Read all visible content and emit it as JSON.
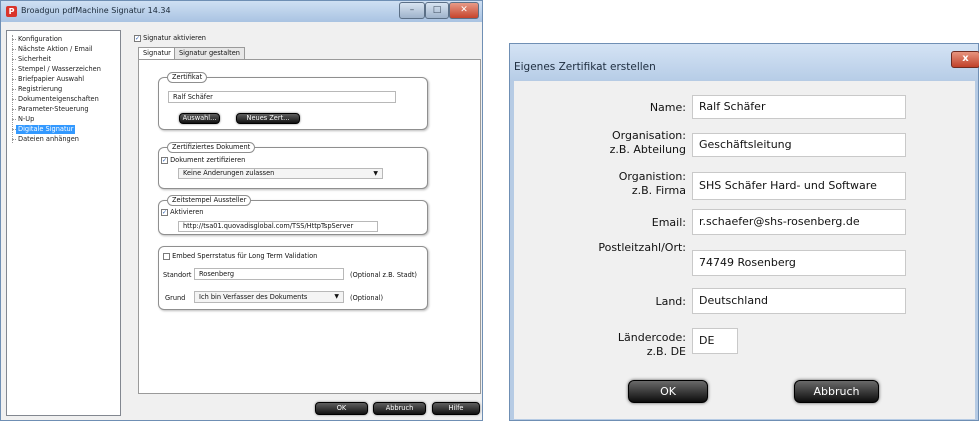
{
  "left_window": {
    "title": "Broadgun pdfMachine Signatur 14.34",
    "tree_items": [
      "Konfiguration",
      "Nächste Aktion / Email",
      "Sicherheit",
      "Stempel / Wasserzeichen",
      "Briefpapier Auswahl",
      "Registrierung",
      "Dokumenteigenschaften",
      "Parameter-Steuerung",
      "N-Up",
      "Digitale Signatur",
      "Dateien anhängen"
    ],
    "selected_tree_item": "Digitale Signatur",
    "enable_signature": {
      "checked": true,
      "label": "Signatur aktivieren"
    },
    "tabs": [
      "Signatur",
      "Signatur gestalten"
    ],
    "active_tab": "Signatur",
    "certificate": {
      "group_title": "Zertifikat",
      "name_value": "Ralf Schäfer",
      "select_button": "Auswahl...",
      "new_cert_button": "Neues Zert..."
    },
    "certified_document": {
      "group_title": "Zertifiziertes Dokument",
      "checkbox_label": "Dokument zertifizieren",
      "checked": true,
      "dropdown_value": "Keine Änderungen zulassen"
    },
    "timestamp": {
      "group_title": "Zeitstempel Aussteller",
      "checkbox_label": "Aktivieren",
      "checked": true,
      "url_value": "http://tsa01.quovadisglobal.com/TSS/HttpTspServer"
    },
    "ltv": {
      "checkbox_label": "Embed Sperrstatus für Long Term Validation",
      "checked": false,
      "location_label": "Standort",
      "location_value": "Rosenberg",
      "location_hint": "(Optional z.B. Stadt)",
      "reason_label": "Grund",
      "reason_value": "Ich bin Verfasser des Dokuments",
      "reason_hint": "(Optional)"
    },
    "buttons": {
      "ok": "OK",
      "cancel": "Abbruch",
      "help": "Hilfe"
    }
  },
  "dialog": {
    "title": "Eigenes Zertifikat erstellen",
    "close_glyph": "x",
    "fields": [
      {
        "label": "Name:",
        "value": "Ralf Schäfer"
      },
      {
        "label": "Organisation:",
        "sublabel": "z.B. Abteilung",
        "value": "Geschäftsleitung"
      },
      {
        "label": "Organistion:",
        "sublabel": "z.B. Firma",
        "value": "SHS Schäfer Hard- und Software"
      },
      {
        "label": "Email:",
        "value": "r.schaefer@shs-rosenberg.de"
      },
      {
        "label": "Postleitzahl/Ort:",
        "value": "74749 Rosenberg"
      },
      {
        "label": "Land:",
        "value": "Deutschland"
      },
      {
        "label": "Ländercode:",
        "sublabel": "z.B. DE",
        "value": "DE"
      }
    ],
    "buttons": {
      "ok": "OK",
      "cancel": "Abbruch"
    }
  },
  "colors": {
    "selection": "#3399ff",
    "dialog_frame": "#b6cbe4",
    "close_button": "#c6442c",
    "button_dark": "#111111"
  }
}
